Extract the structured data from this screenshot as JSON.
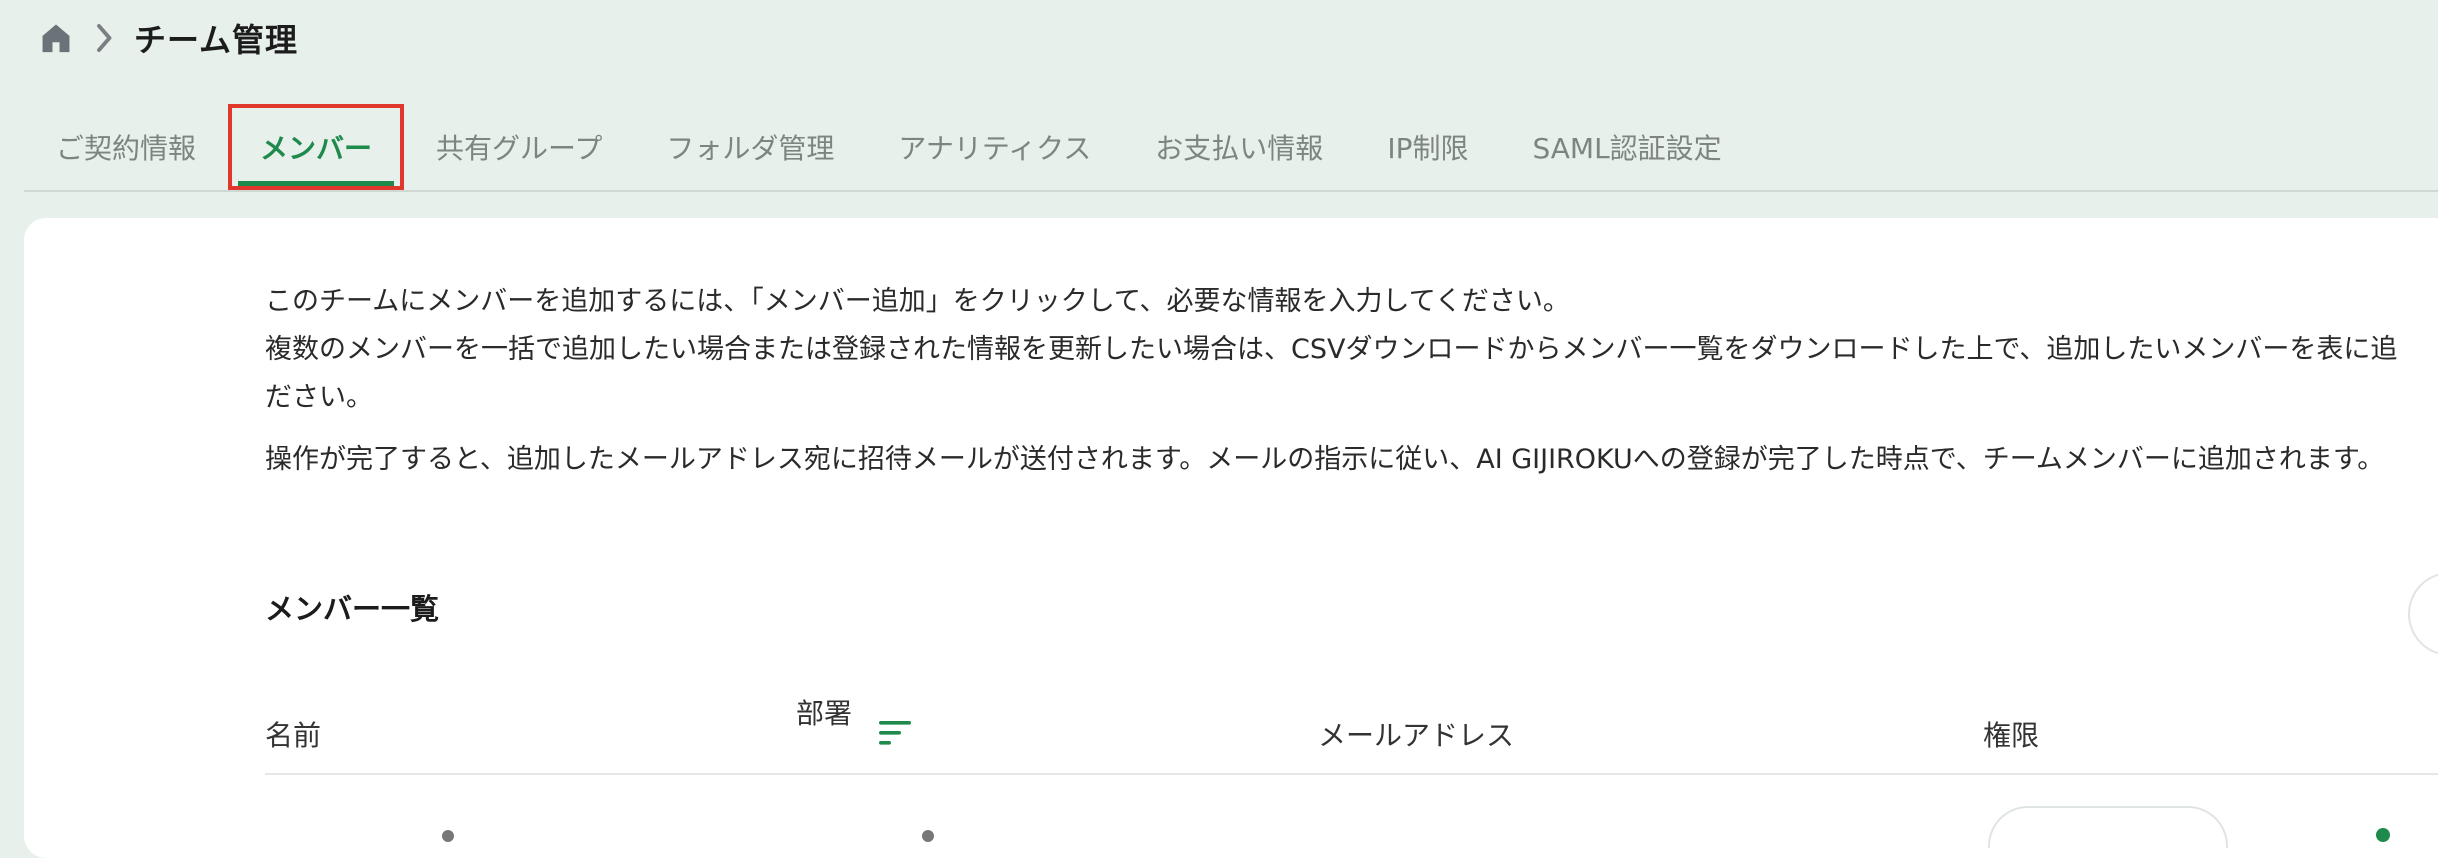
{
  "breadcrumb": {
    "title": "チーム管理",
    "home_icon": "home-icon",
    "separator_icon": "chevron-right-icon"
  },
  "tabs": [
    {
      "label": "ご契約情報",
      "active": false
    },
    {
      "label": "メンバー",
      "active": true
    },
    {
      "label": "共有グループ",
      "active": false
    },
    {
      "label": "フォルダ管理",
      "active": false
    },
    {
      "label": "アナリティクス",
      "active": false
    },
    {
      "label": "お支払い情報",
      "active": false
    },
    {
      "label": "IP制限",
      "active": false
    },
    {
      "label": "SAML認証設定",
      "active": false
    }
  ],
  "intro": {
    "line1": "このチームにメンバーを追加するには、「メンバー追加」をクリックして、必要な情報を入力してください。",
    "line2": "複数のメンバーを一括で追加したい場合または登録された情報を更新したい場合は、CSVダウンロードからメンバー一覧をダウンロードした上で、追加したいメンバーを表に追",
    "line3": "ださい。",
    "line4": "操作が完了すると、追加したメールアドレス宛に招待メールが送付されます。メールの指示に従い、AI GIJIROKUへの登録が完了した時点で、チームメンバーに追加されます。"
  },
  "members": {
    "section_title": "メンバー一覧",
    "columns": {
      "name": "名前",
      "department": "部署",
      "email": "メールアドレス",
      "role": "権限"
    },
    "filter_icon": "sort-filter-icon"
  },
  "colors": {
    "accent": "#1e8a4c",
    "highlight": "#e0362b",
    "background": "#e8f0ec"
  }
}
